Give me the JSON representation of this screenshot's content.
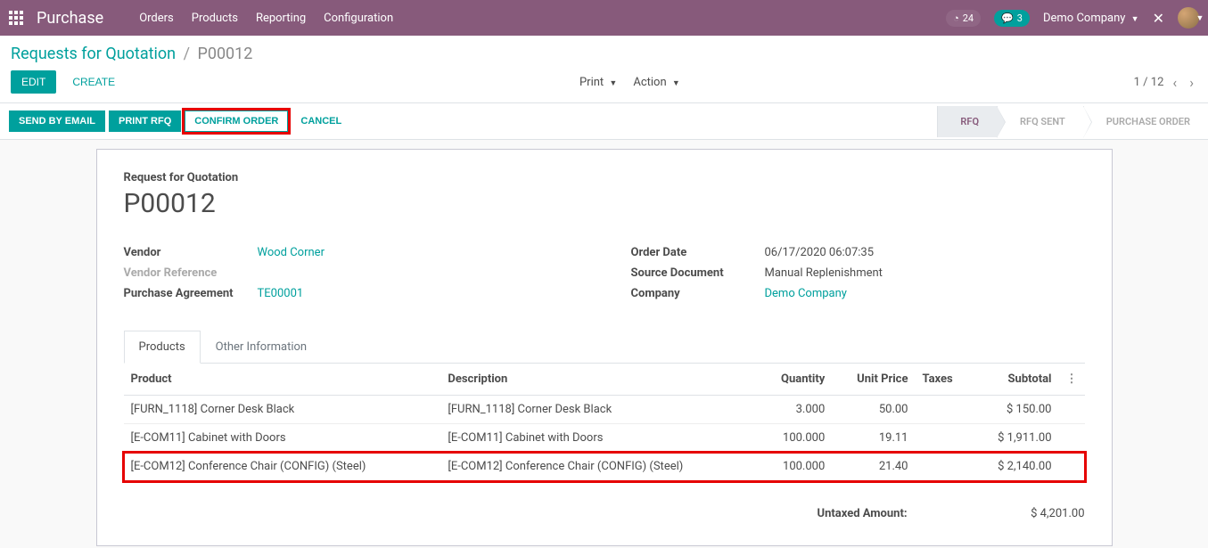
{
  "nav": {
    "app_title": "Purchase",
    "menu": [
      "Orders",
      "Products",
      "Reporting",
      "Configuration"
    ],
    "activity_count": "24",
    "chat_count": "3",
    "company": "Demo Company"
  },
  "breadcrumb": {
    "parent": "Requests for Quotation",
    "current": "P00012"
  },
  "controls": {
    "edit": "EDIT",
    "create": "CREATE",
    "print": "Print",
    "action": "Action",
    "pager": "1 / 12"
  },
  "status": {
    "send_email": "SEND BY EMAIL",
    "print_rfq": "PRINT RFQ",
    "confirm_order": "CONFIRM ORDER",
    "cancel": "CANCEL",
    "stages": [
      "RFQ",
      "RFQ SENT",
      "PURCHASE ORDER"
    ]
  },
  "form": {
    "subtitle": "Request for Quotation",
    "title": "P00012",
    "left": {
      "vendor_label": "Vendor",
      "vendor_value": "Wood Corner",
      "vendor_ref_label": "Vendor Reference",
      "vendor_ref_value": "",
      "agreement_label": "Purchase Agreement",
      "agreement_value": "TE00001"
    },
    "right": {
      "order_date_label": "Order Date",
      "order_date_value": "06/17/2020 06:07:35",
      "source_label": "Source Document",
      "source_value": "Manual Replenishment",
      "company_label": "Company",
      "company_value": "Demo Company"
    },
    "tabs": [
      "Products",
      "Other Information"
    ],
    "table": {
      "headers": {
        "product": "Product",
        "description": "Description",
        "quantity": "Quantity",
        "unit_price": "Unit Price",
        "taxes": "Taxes",
        "subtotal": "Subtotal"
      },
      "rows": [
        {
          "product": "[FURN_1118] Corner Desk Black",
          "description": "[FURN_1118] Corner Desk Black",
          "quantity": "3.000",
          "unit_price": "50.00",
          "taxes": "",
          "subtotal": "$ 150.00"
        },
        {
          "product": "[E-COM11] Cabinet with Doors",
          "description": "[E-COM11] Cabinet with Doors",
          "quantity": "100.000",
          "unit_price": "19.11",
          "taxes": "",
          "subtotal": "$ 1,911.00"
        },
        {
          "product": "[E-COM12] Conference Chair (CONFIG) (Steel)",
          "description": "[E-COM12] Conference Chair (CONFIG) (Steel)",
          "quantity": "100.000",
          "unit_price": "21.40",
          "taxes": "",
          "subtotal": "$ 2,140.00"
        }
      ]
    },
    "totals": {
      "untaxed_label": "Untaxed Amount:",
      "untaxed_value": "$ 4,201.00"
    }
  }
}
